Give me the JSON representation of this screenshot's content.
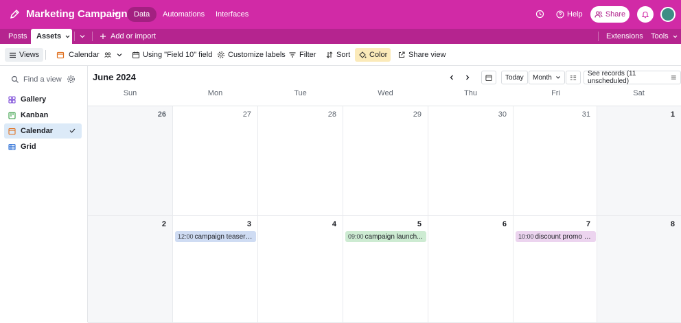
{
  "topbar": {
    "title": "Marketing Campaign",
    "nav": [
      "Data",
      "Automations",
      "Interfaces"
    ],
    "help_label": "Help",
    "share_label": "Share"
  },
  "tabs": {
    "items": [
      "Posts",
      "Assets"
    ],
    "add_label": "Add or import",
    "extensions_label": "Extensions",
    "tools_label": "Tools"
  },
  "toolbar": {
    "views_label": "Views",
    "calendar_label": "Calendar",
    "using_field_label": "Using \"Field 10\" field",
    "customize_labels": "Customize labels",
    "filter_label": "Filter",
    "sort_label": "Sort",
    "color_label": "Color",
    "share_view_label": "Share view"
  },
  "sidebar": {
    "find_placeholder": "Find a view",
    "views": [
      {
        "label": "Gallery",
        "icon": "gallery-icon"
      },
      {
        "label": "Kanban",
        "icon": "kanban-icon"
      },
      {
        "label": "Calendar",
        "icon": "calendar-icon"
      },
      {
        "label": "Grid",
        "icon": "grid-icon"
      }
    ]
  },
  "calendar": {
    "month_label": "June 2024",
    "today_label": "Today",
    "range_label": "Month",
    "records_label": "See records (11 unscheduled)",
    "days": [
      "Sun",
      "Mon",
      "Tue",
      "Wed",
      "Thu",
      "Fri",
      "Sat"
    ],
    "week1": [
      "26",
      "27",
      "28",
      "29",
      "30",
      "31",
      "1"
    ],
    "week2": [
      "2",
      "3",
      "4",
      "5",
      "6",
      "7",
      "8"
    ],
    "events": [
      {
        "time": "12:00",
        "title": "campaign teaser · ...",
        "color": "#cfdcf3"
      },
      {
        "time": "09:00",
        "title": "campaign launch...",
        "color": "#cdebd2"
      },
      {
        "time": "10:00",
        "title": "discount promo · ...",
        "color": "#ecd4ef"
      }
    ]
  },
  "colors": {
    "brand": "#d12aa6",
    "tabbar": "#b5248f",
    "selected_view": "#dceaf8"
  }
}
